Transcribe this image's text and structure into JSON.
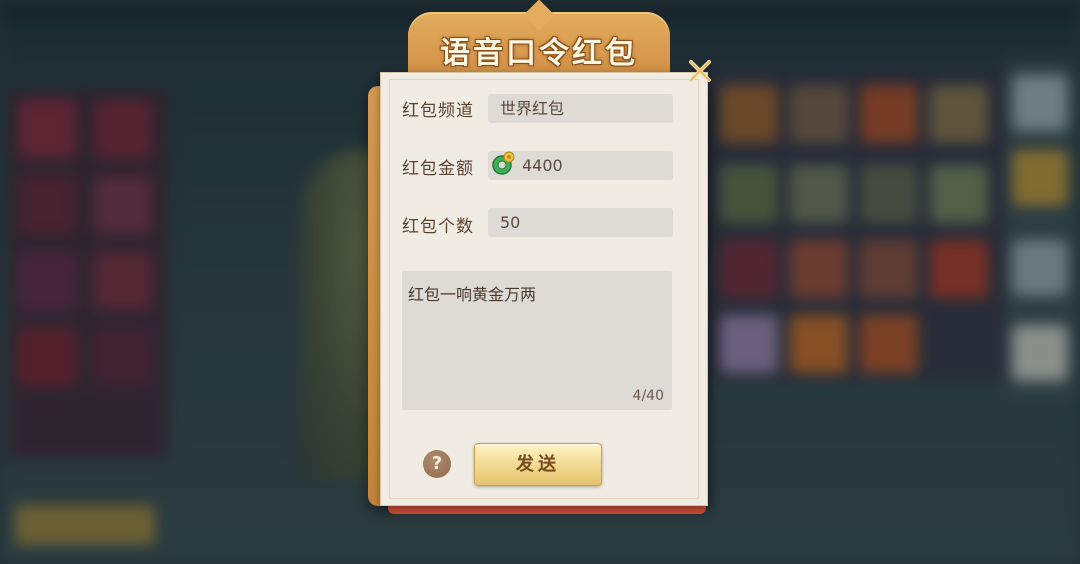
{
  "dialog": {
    "title": "语音口令红包",
    "fields": {
      "channel": {
        "label": "红包频道",
        "value": "世界红包"
      },
      "amount": {
        "label": "红包金额",
        "value": "4400",
        "icon": "jade-currency-icon"
      },
      "count": {
        "label": "红包个数",
        "value": "50"
      }
    },
    "message": {
      "text": "红包一响黄金万两",
      "counter": "4/40"
    },
    "help_label": "?",
    "send_label": "发送",
    "close_icon": "close-icon"
  },
  "colors": {
    "panel": "#f1ece3",
    "frame": "#d49a52",
    "field_bg": "#dedbd6",
    "label_text": "#5a4230",
    "send_button": "#f2dd98"
  }
}
